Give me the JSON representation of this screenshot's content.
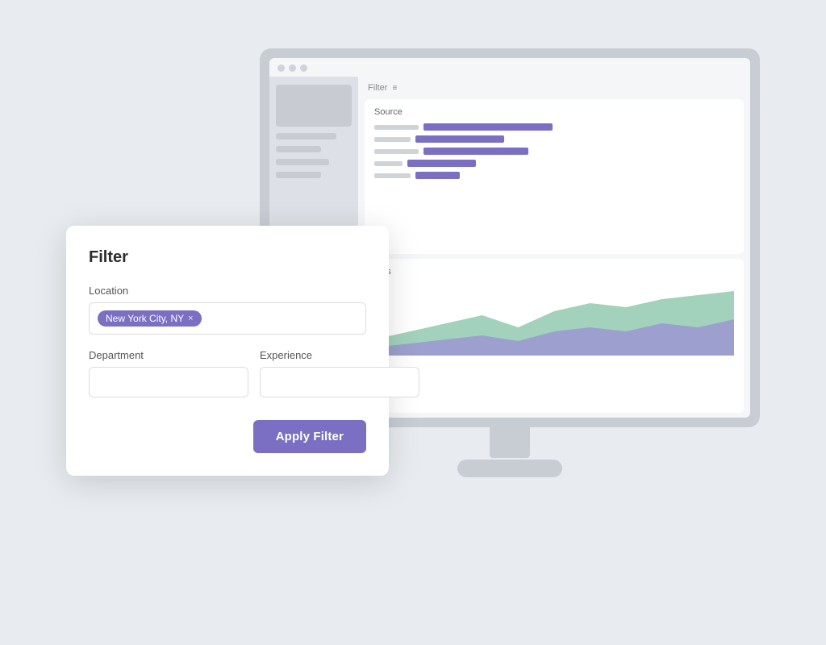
{
  "monitor": {
    "traffic_lights": [
      "red",
      "yellow",
      "green"
    ],
    "filter_bar_label": "Filter",
    "filter_icon": "≡",
    "chart1": {
      "title": "Source",
      "bars": [
        {
          "label_width": 55,
          "fill_width": 160
        },
        {
          "label_width": 45,
          "fill_width": 110
        },
        {
          "label_width": 55,
          "fill_width": 130
        },
        {
          "label_width": 35,
          "fill_width": 85
        },
        {
          "label_width": 45,
          "fill_width": 60
        }
      ]
    },
    "chart2": {
      "title": "ants"
    }
  },
  "dialog": {
    "title": "Filter",
    "location_label": "Location",
    "location_tag": "New York City, NY",
    "location_tag_close": "×",
    "department_label": "Department",
    "department_placeholder": "",
    "experience_label": "Experience",
    "experience_placeholder": "",
    "apply_button_label": "Apply Filter"
  },
  "colors": {
    "purple": "#7b6fc4",
    "green_area": "#7bbfa0",
    "purple_area": "#9b8fd4",
    "monitor_bg": "#c8cdd4",
    "screen_bg": "#f5f6f8"
  }
}
